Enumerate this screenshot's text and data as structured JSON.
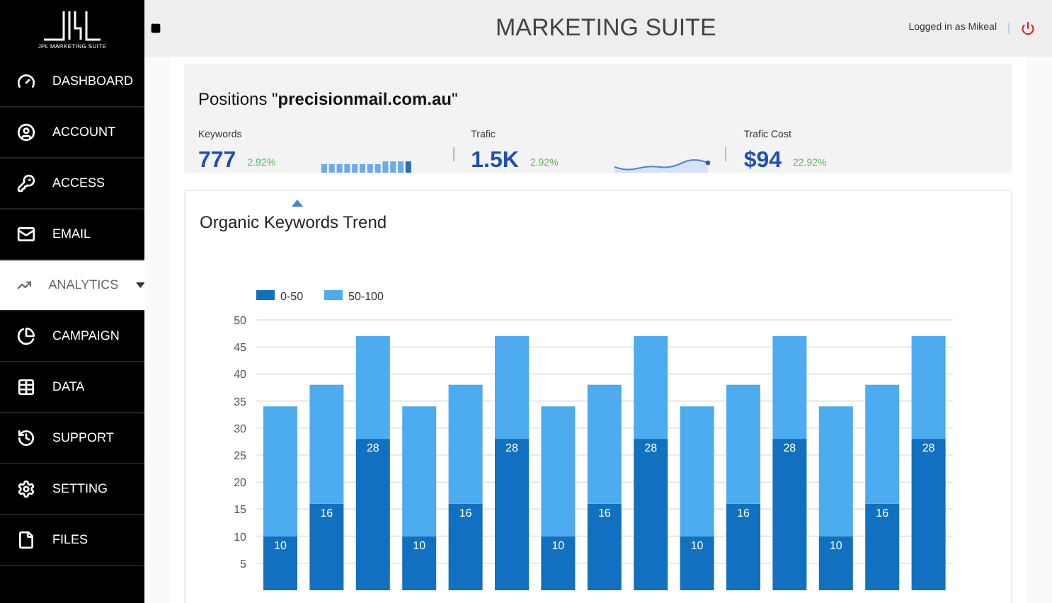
{
  "logo": {
    "text": "JPL MARKETING SUITE"
  },
  "sidebar": {
    "items": [
      {
        "label": "DASHBOARD",
        "kind": "dashboard",
        "selected": false,
        "submenu": false
      },
      {
        "label": "ACCOUNT",
        "kind": "account",
        "selected": false,
        "submenu": false
      },
      {
        "label": "ACCESS",
        "kind": "access",
        "selected": false,
        "submenu": false
      },
      {
        "label": "EMAIL",
        "kind": "email",
        "selected": false,
        "submenu": false
      },
      {
        "label": "ANALYTICS",
        "kind": "analytics",
        "selected": true,
        "submenu": true
      },
      {
        "label": "CAMPAIGN",
        "kind": "campaign",
        "selected": false,
        "submenu": false
      },
      {
        "label": "DATA",
        "kind": "data",
        "selected": false,
        "submenu": false
      },
      {
        "label": "SUPPORT",
        "kind": "support",
        "selected": false,
        "submenu": false
      },
      {
        "label": "SETTING",
        "kind": "setting",
        "selected": false,
        "submenu": false
      },
      {
        "label": "FILES",
        "kind": "files",
        "selected": false,
        "submenu": false
      }
    ]
  },
  "header": {
    "title": "MARKETING SUITE",
    "user": "Logged in as Mikeal"
  },
  "positions": {
    "title": "Positions \"**precisionmail.com.au**\"",
    "stats": [
      {
        "label": "Keywords",
        "value": "777",
        "change": "2.92%",
        "kind": "bars",
        "selected": true
      },
      {
        "label": "Trafic",
        "value": "1.5K",
        "change": "2.92%",
        "kind": "line",
        "selected": false
      },
      {
        "label": "Trafic Cost",
        "value": "$94",
        "change": "22.92%",
        "kind": "none",
        "selected": false
      }
    ]
  },
  "trend": {
    "title": "Organic Keywords Trend",
    "chart_data": {
      "type": "bar",
      "stacked": true,
      "grid": true,
      "legend": "top-left",
      "ylim": [
        0,
        50
      ],
      "yticks": [
        5,
        10,
        15,
        20,
        25,
        30,
        35,
        40,
        45,
        50
      ],
      "series": [
        {
          "name": "0-50",
          "color": "#1170c0",
          "values": [
            10,
            16,
            28,
            10,
            16,
            28,
            10,
            16,
            28,
            10,
            16,
            28,
            10,
            16,
            28
          ]
        },
        {
          "name": "50-100",
          "color": "#4dabf0",
          "values": [
            24,
            22,
            19,
            24,
            22,
            19,
            24,
            22,
            19,
            24,
            22,
            19,
            24,
            22,
            19
          ]
        }
      ],
      "value_labels": [
        [
          "10",
          "16",
          "28",
          "10",
          "16",
          "28",
          "10",
          "16",
          "28",
          "10",
          "16",
          "28",
          "10",
          "16",
          "28"
        ],
        [
          null,
          null,
          null,
          null,
          null,
          null,
          null,
          null,
          null,
          null,
          null,
          null,
          null,
          null,
          null
        ]
      ]
    }
  }
}
